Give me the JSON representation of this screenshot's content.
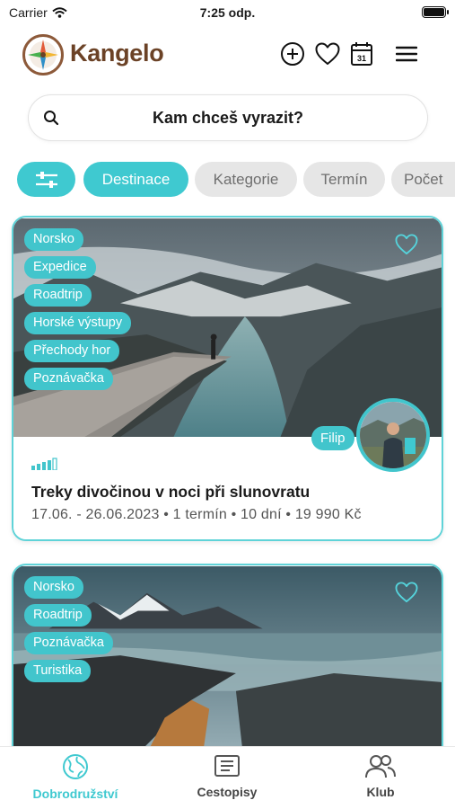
{
  "status_bar": {
    "carrier": "Carrier",
    "time": "7:25 odp."
  },
  "header": {
    "brand": "Kangelo"
  },
  "search": {
    "placeholder": "Kam chceš vyrazit?"
  },
  "filters": [
    "Destinace",
    "Kategorie",
    "Termín",
    "Počet"
  ],
  "cards": [
    {
      "tags": [
        "Norsko",
        "Expedice",
        "Roadtrip",
        "Horské výstupy",
        "Přechody hor",
        "Poznávačka"
      ],
      "author": "Filip",
      "title": "Treky divočinou v noci při slunovratu",
      "meta": "17.06. - 26.06.2023 • 1 termín • 10 dní • 19 990 Kč"
    },
    {
      "tags": [
        "Norsko",
        "Roadtrip",
        "Poznávačka",
        "Turistika"
      ]
    }
  ],
  "bottom_nav": [
    {
      "label": "Dobrodružství",
      "active": true
    },
    {
      "label": "Cestopisy",
      "active": false
    },
    {
      "label": "Klub",
      "active": false
    }
  ],
  "colors": {
    "accent": "#3fc9d0",
    "brand": "#6b4226",
    "chip_idle": "#e6e6e6"
  },
  "icons": [
    "wifi-icon",
    "battery-icon",
    "compass-logo",
    "add-icon",
    "heart-icon",
    "calendar-icon",
    "menu-icon",
    "search-icon",
    "filter-sliders-icon",
    "favorite-icon",
    "difficulty-icon",
    "globe-icon",
    "book-icon",
    "users-icon"
  ]
}
